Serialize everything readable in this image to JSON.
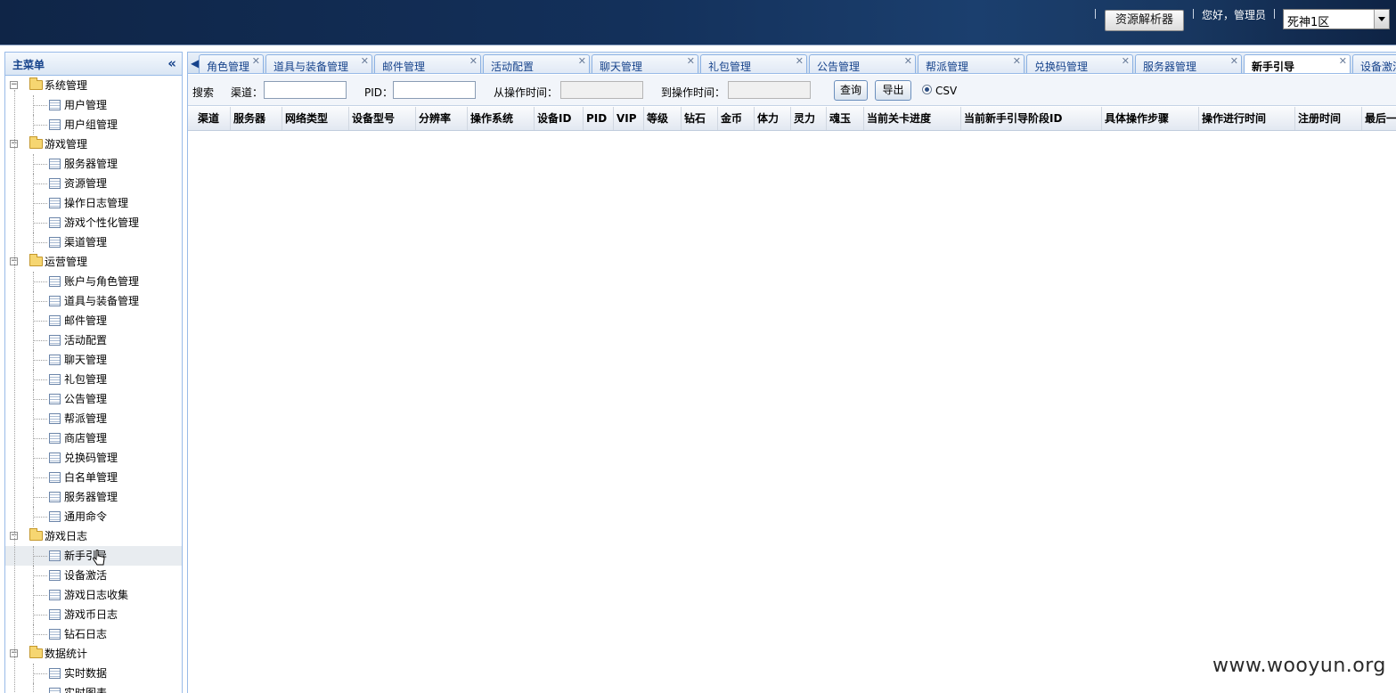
{
  "topbar": {
    "resolver_button": "资源解析器",
    "greeting": "您好，管理员",
    "server_select": "死神1区"
  },
  "sidebar": {
    "title": "主菜单",
    "groups": [
      {
        "label": "系统管理",
        "items": [
          "用户管理",
          "用户组管理"
        ]
      },
      {
        "label": "游戏管理",
        "items": [
          "服务器管理",
          "资源管理",
          "操作日志管理",
          "游戏个性化管理",
          "渠道管理"
        ]
      },
      {
        "label": "运营管理",
        "items": [
          "账户与角色管理",
          "道具与装备管理",
          "邮件管理",
          "活动配置",
          "聊天管理",
          "礼包管理",
          "公告管理",
          "帮派管理",
          "商店管理",
          "兑换码管理",
          "白名单管理",
          "服务器管理",
          "通用命令"
        ]
      },
      {
        "label": "游戏日志",
        "items": [
          "新手引导",
          "设备激活",
          "游戏日志收集",
          "游戏币日志",
          "钻石日志"
        ]
      },
      {
        "label": "数据统计",
        "items": [
          "实时数据",
          "实时图表"
        ]
      }
    ],
    "selected": "新手引导"
  },
  "tabs": {
    "items": [
      "角色管理",
      "道具与装备管理",
      "邮件管理",
      "活动配置",
      "聊天管理",
      "礼包管理",
      "公告管理",
      "帮派管理",
      "兑换码管理",
      "服务器管理",
      "新手引导",
      "设备激活"
    ],
    "active": "新手引导"
  },
  "search": {
    "label": "搜索",
    "channel_label": "渠道：",
    "pid_label": "PID：",
    "from_label": "从操作时间：",
    "to_label": "到操作时间：",
    "query_button": "查询",
    "export_button": "导出",
    "csv_label": "CSV"
  },
  "grid": {
    "columns": [
      "渠道",
      "服务器",
      "网络类型",
      "设备型号",
      "分辨率",
      "操作系统",
      "设备ID",
      "PID",
      "VIP",
      "等级",
      "钻石",
      "金币",
      "体力",
      "灵力",
      "魂玉",
      "当前关卡进度",
      "当前新手引导阶段ID",
      "具体操作步骤",
      "操作进行时间",
      "注册时间",
      "最后一"
    ]
  },
  "watermark": "www.wooyun.org"
}
